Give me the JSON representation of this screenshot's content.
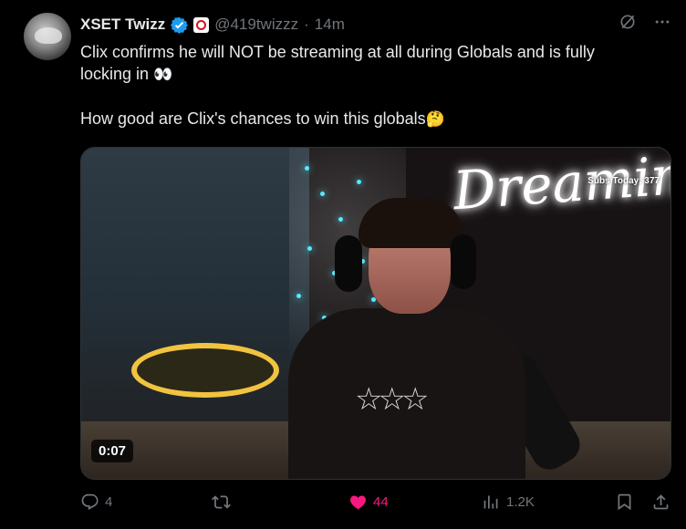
{
  "author": {
    "name": "XSET Twizz",
    "handle": "@419twizzz",
    "separator": "·",
    "time": "14m"
  },
  "tweet": {
    "text_line_1": "Clix confirms he will NOT be streaming at all during Globals and is fully\nlocking in",
    "emoji_1": "👀",
    "text_line_2": "How good are Clix's chances to win this globals",
    "emoji_2": "🤔"
  },
  "media": {
    "neon_sign_text": "Dreamin",
    "subs_text": "Subs Today: 377",
    "duration": "0:07"
  },
  "actions": {
    "reply_count": "4",
    "repost_count": "",
    "like_count": "44",
    "views_count": "1.2K"
  },
  "icons": {
    "verified": "verified-icon",
    "reply": "reply-icon",
    "repost": "repost-icon",
    "like": "heart-icon",
    "views": "views-icon",
    "bookmark": "bookmark-icon",
    "share": "share-icon",
    "grok": "grok-icon",
    "more": "more-icon"
  },
  "colors": {
    "background": "#000000",
    "text": "#e7e9ea",
    "muted": "#71767b",
    "like": "#f91880",
    "verified": "#1d9bf0"
  }
}
